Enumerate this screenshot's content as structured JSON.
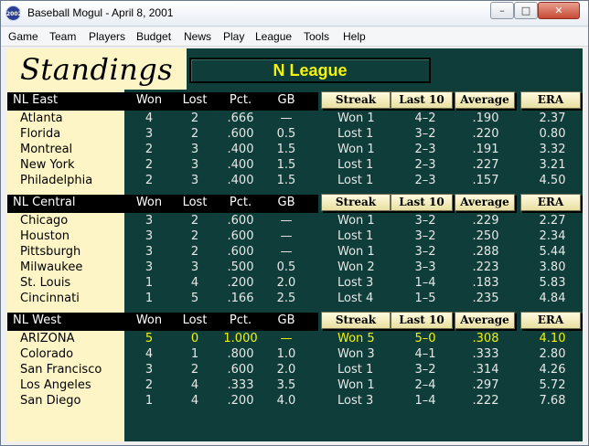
{
  "window": {
    "title": "Baseball Mogul - April 8, 2001",
    "icon_text": "2002"
  },
  "menu": [
    "Game",
    "Team",
    "Players",
    "Budget",
    "News",
    "Play",
    "League",
    "Tools",
    "Help"
  ],
  "page": {
    "title": "Standings",
    "league": "N League"
  },
  "columns": {
    "won": "Won",
    "lost": "Lost",
    "pct": "Pct.",
    "gb": "GB"
  },
  "tabs": {
    "streak": "Streak",
    "last10": "Last 10",
    "average": "Average",
    "era": "ERA"
  },
  "colors": {
    "background": "#0e3d3a",
    "accent": "#f3f30c",
    "panel": "#fdf5c6"
  },
  "divisions": [
    {
      "name": "NL East",
      "teams": [
        {
          "team": "Atlanta",
          "won": "4",
          "lost": "2",
          "pct": ".666",
          "gb": "—",
          "streak": "Won 1",
          "last10": "4–2",
          "avg": ".190",
          "era": "2.37"
        },
        {
          "team": "Florida",
          "won": "3",
          "lost": "2",
          "pct": ".600",
          "gb": "0.5",
          "streak": "Lost 1",
          "last10": "3–2",
          "avg": ".220",
          "era": "0.80"
        },
        {
          "team": "Montreal",
          "won": "2",
          "lost": "3",
          "pct": ".400",
          "gb": "1.5",
          "streak": "Won 1",
          "last10": "2–3",
          "avg": ".191",
          "era": "3.32"
        },
        {
          "team": "New York",
          "won": "2",
          "lost": "3",
          "pct": ".400",
          "gb": "1.5",
          "streak": "Lost 1",
          "last10": "2–3",
          "avg": ".227",
          "era": "3.21"
        },
        {
          "team": "Philadelphia",
          "won": "2",
          "lost": "3",
          "pct": ".400",
          "gb": "1.5",
          "streak": "Lost 1",
          "last10": "2–3",
          "avg": ".157",
          "era": "4.50"
        }
      ]
    },
    {
      "name": "NL Central",
      "teams": [
        {
          "team": "Chicago",
          "won": "3",
          "lost": "2",
          "pct": ".600",
          "gb": "—",
          "streak": "Won 1",
          "last10": "3–2",
          "avg": ".229",
          "era": "2.27"
        },
        {
          "team": "Houston",
          "won": "3",
          "lost": "2",
          "pct": ".600",
          "gb": "—",
          "streak": "Lost 1",
          "last10": "3–2",
          "avg": ".250",
          "era": "2.34"
        },
        {
          "team": "Pittsburgh",
          "won": "3",
          "lost": "2",
          "pct": ".600",
          "gb": "—",
          "streak": "Won 1",
          "last10": "3–2",
          "avg": ".288",
          "era": "5.44"
        },
        {
          "team": "Milwaukee",
          "won": "3",
          "lost": "3",
          "pct": ".500",
          "gb": "0.5",
          "streak": "Won 2",
          "last10": "3–3",
          "avg": ".223",
          "era": "3.80"
        },
        {
          "team": "St. Louis",
          "won": "1",
          "lost": "4",
          "pct": ".200",
          "gb": "2.0",
          "streak": "Lost 3",
          "last10": "1–4",
          "avg": ".183",
          "era": "5.83"
        },
        {
          "team": "Cincinnati",
          "won": "1",
          "lost": "5",
          "pct": ".166",
          "gb": "2.5",
          "streak": "Lost 4",
          "last10": "1–5",
          "avg": ".235",
          "era": "4.84"
        }
      ]
    },
    {
      "name": "NL West",
      "teams": [
        {
          "team": "ARIZONA",
          "won": "5",
          "lost": "0",
          "pct": "1.000",
          "gb": "—",
          "streak": "Won 5",
          "last10": "5–0",
          "avg": ".308",
          "era": "4.10",
          "highlight": true
        },
        {
          "team": "Colorado",
          "won": "4",
          "lost": "1",
          "pct": ".800",
          "gb": "1.0",
          "streak": "Won 3",
          "last10": "4–1",
          "avg": ".333",
          "era": "2.80"
        },
        {
          "team": "San Francisco",
          "won": "3",
          "lost": "2",
          "pct": ".600",
          "gb": "2.0",
          "streak": "Lost 1",
          "last10": "3–2",
          "avg": ".314",
          "era": "4.26"
        },
        {
          "team": "Los Angeles",
          "won": "2",
          "lost": "4",
          "pct": ".333",
          "gb": "3.5",
          "streak": "Won 1",
          "last10": "2–4",
          "avg": ".297",
          "era": "5.72"
        },
        {
          "team": "San Diego",
          "won": "1",
          "lost": "4",
          "pct": ".200",
          "gb": "4.0",
          "streak": "Lost 3",
          "last10": "1–4",
          "avg": ".222",
          "era": "7.68"
        }
      ]
    }
  ]
}
